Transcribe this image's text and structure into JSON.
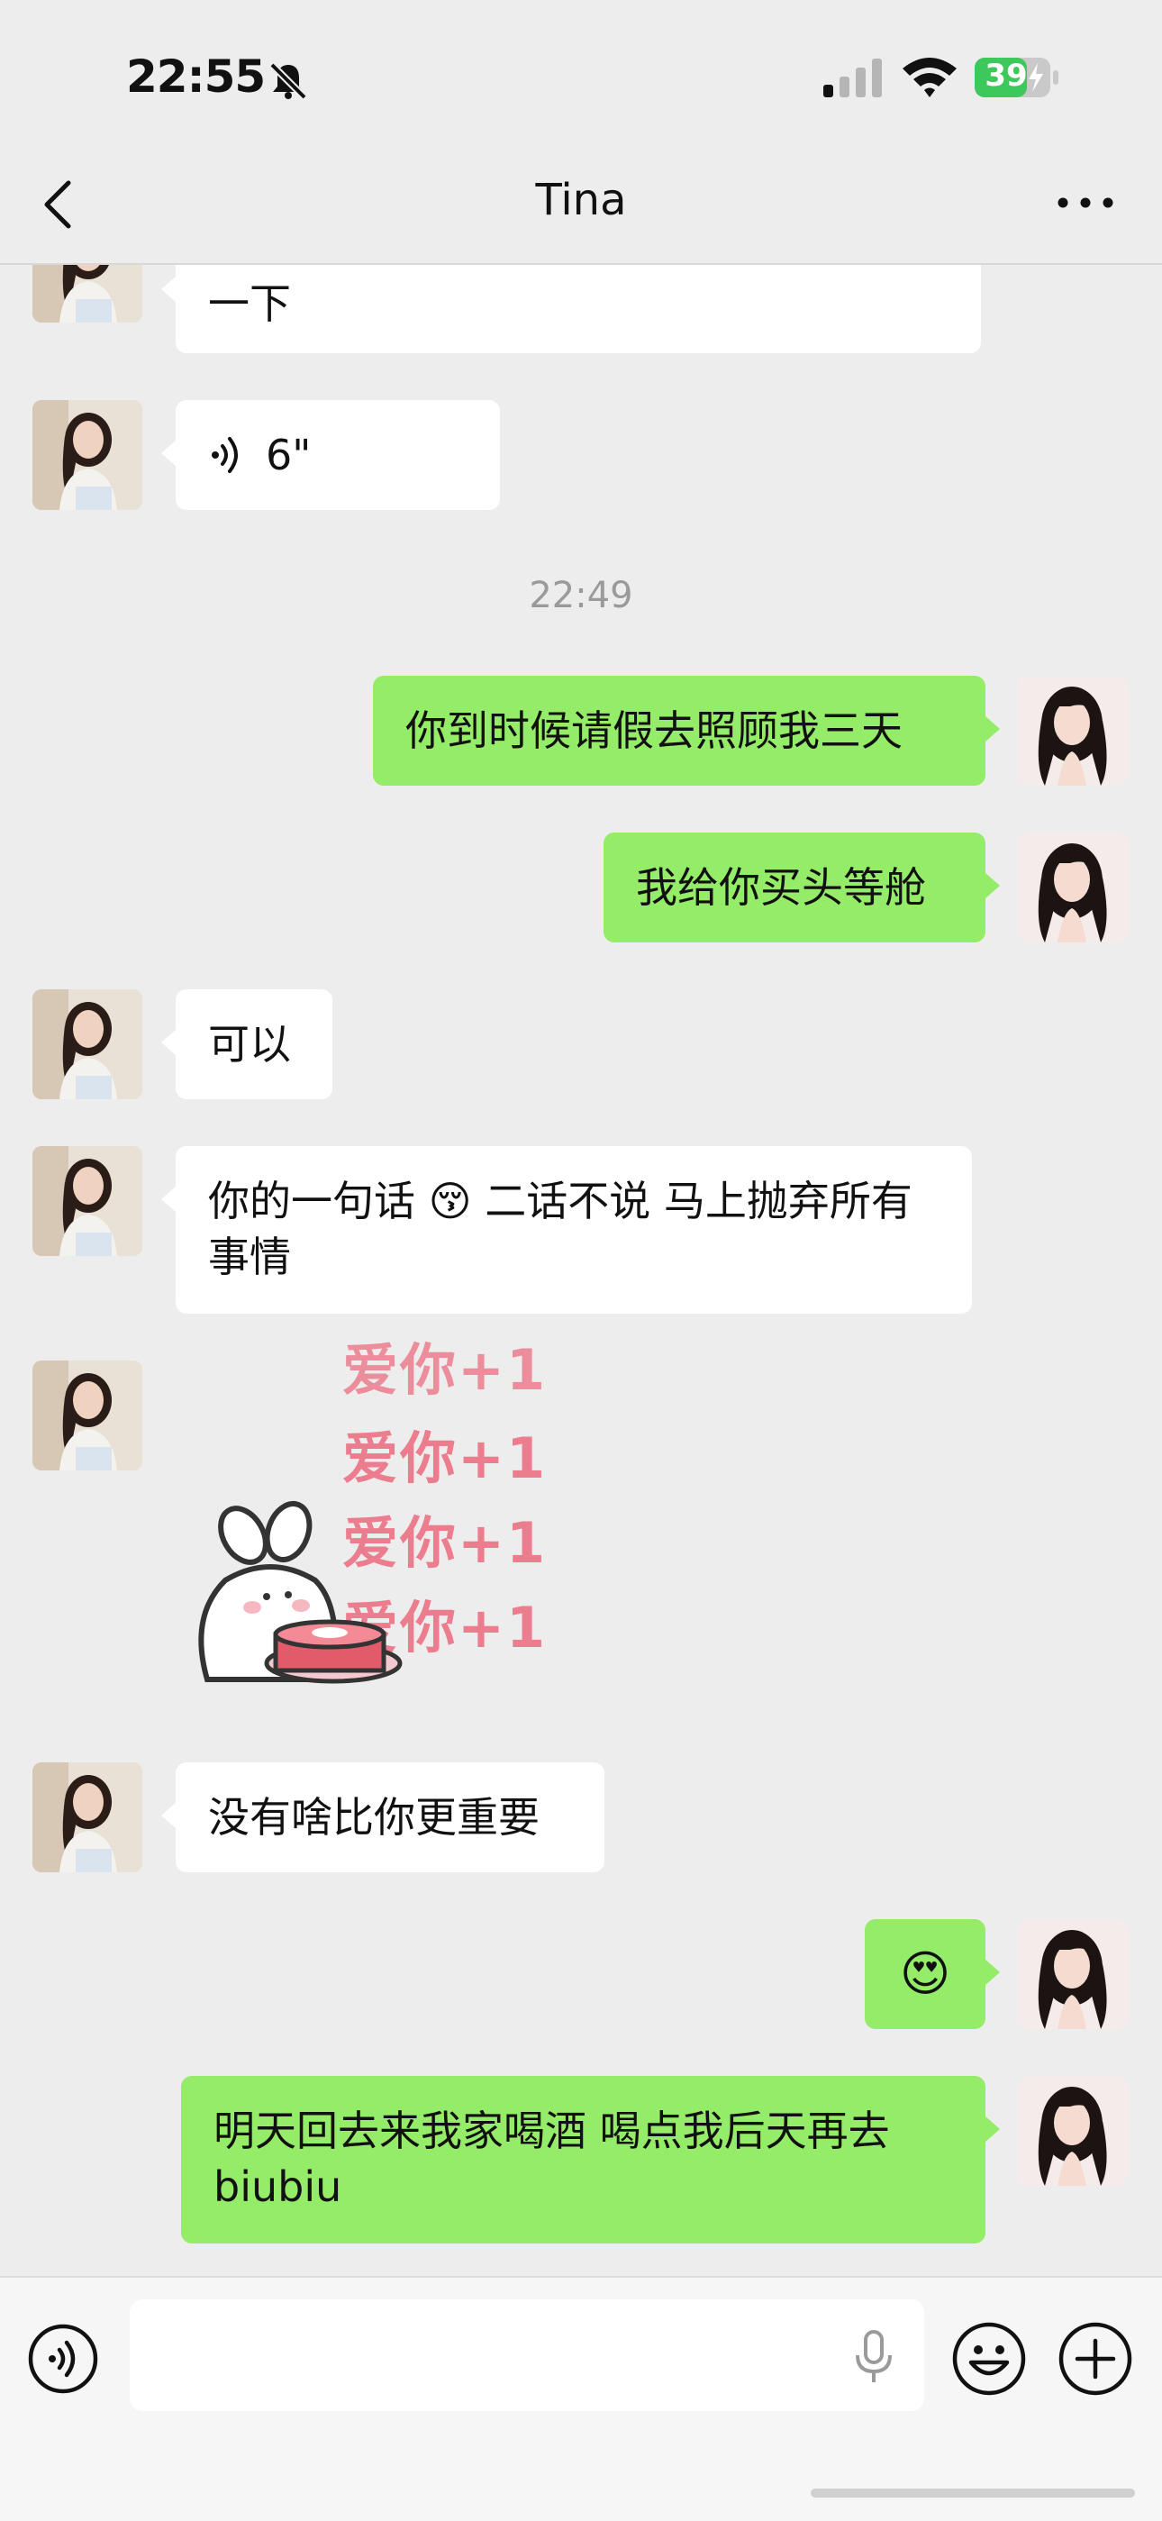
{
  "status_bar": {
    "time": "22:55",
    "battery": "39"
  },
  "nav": {
    "title": "Tina"
  },
  "messages": [
    {
      "side": "in",
      "text": "一下"
    },
    {
      "side": "in",
      "type": "voice",
      "text": "6\""
    },
    {
      "type": "timestamp",
      "text": "22:49"
    },
    {
      "side": "out",
      "text": "你到时候请假去照顾我三天"
    },
    {
      "side": "out",
      "text": "我给你买头等舱"
    },
    {
      "side": "in",
      "text": "可以"
    },
    {
      "side": "in",
      "text": "你的一句话 😚 二话不说 马上抛弃所有事情"
    },
    {
      "side": "in",
      "type": "sticker",
      "text": "爱你+1"
    },
    {
      "side": "in",
      "text": "没有啥比你更重要"
    },
    {
      "side": "out",
      "text": "😍"
    },
    {
      "side": "out",
      "text": "明天回去来我家喝酒 喝点我后天再去biubiu"
    }
  ],
  "icons": {
    "back": "chevron-left-icon",
    "more": "more-icon",
    "voice": "voice-icon",
    "mic": "microphone-icon",
    "emoji": "emoji-icon",
    "plus": "plus-icon"
  },
  "colors": {
    "outgoing_bubble": "#95ec69",
    "incoming_bubble": "#ffffff",
    "background": "#ededed"
  }
}
